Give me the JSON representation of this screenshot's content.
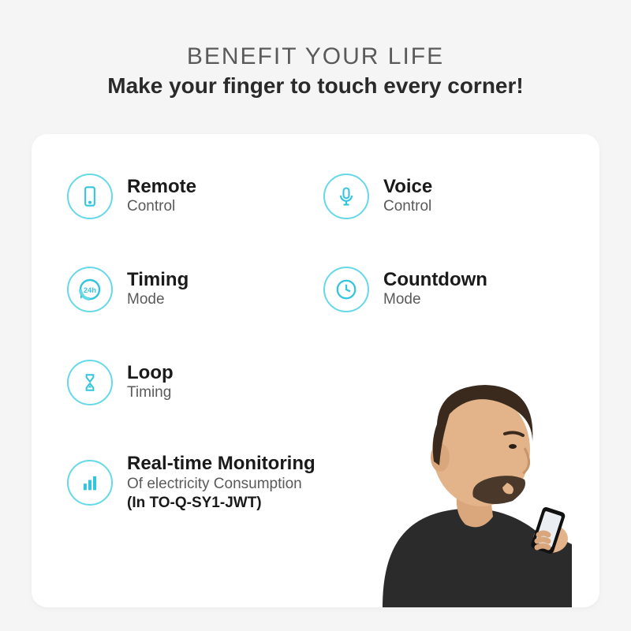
{
  "header": {
    "title": "BENEFIT YOUR LIFE",
    "subtitle": "Make your finger to touch every corner!"
  },
  "features": [
    {
      "icon": "phone",
      "line1": "Remote",
      "line2": "Control"
    },
    {
      "icon": "mic",
      "line1": "Voice",
      "line2": "Control"
    },
    {
      "icon": "24h",
      "line1": "Timing",
      "line2": "Mode"
    },
    {
      "icon": "clock",
      "line1": "Countdown",
      "line2": "Mode"
    },
    {
      "icon": "hourglass",
      "line1": "Loop",
      "line2": "Timing"
    },
    {
      "icon": "bars",
      "line1": "Real-time Monitoring",
      "line2": "Of electricity Consumption",
      "line3": "(In TO-Q-SY1-JWT)",
      "wide": true
    }
  ],
  "colors": {
    "accent": "#33c5dd"
  }
}
